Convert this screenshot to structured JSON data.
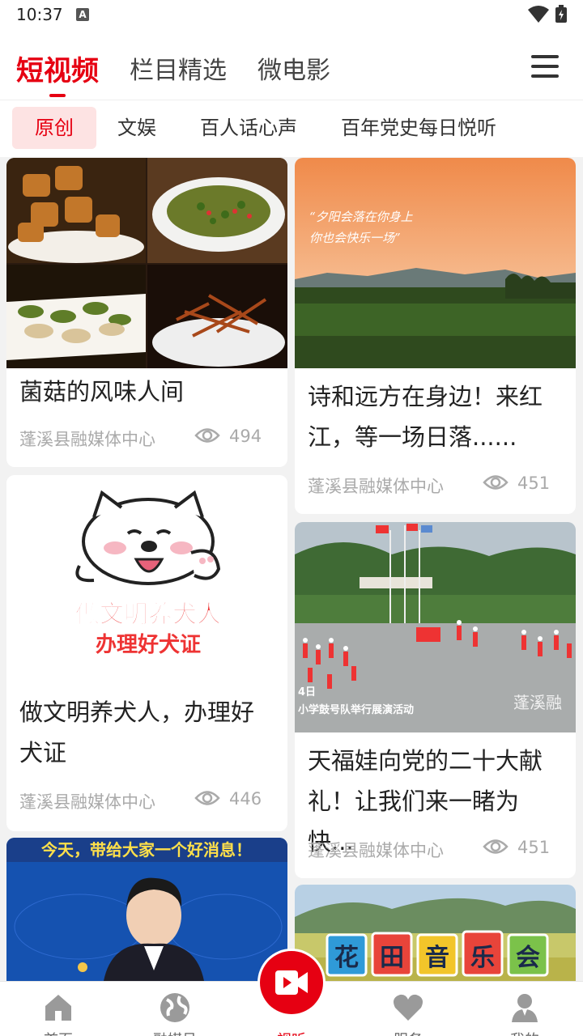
{
  "status": {
    "time": "10:37"
  },
  "top_tabs": [
    {
      "label": "短视频"
    },
    {
      "label": "栏目精选"
    },
    {
      "label": "微电影"
    }
  ],
  "sub_tabs": [
    {
      "label": "原创"
    },
    {
      "label": "文娱"
    },
    {
      "label": "百人话心声"
    },
    {
      "label": "百年党史每日悦听"
    }
  ],
  "cards": [
    {
      "title": "菌菇的风味人间",
      "source": "蓬溪县融媒体中心",
      "views": "494"
    },
    {
      "title": "诗和远方在身边！来红江，等一场日落......",
      "source": "蓬溪县融媒体中心",
      "views": "451",
      "overlay_text": "“夕阳会落在你身上 你也会快乐一场”"
    },
    {
      "title": "做文明养犬人，办理好犬证",
      "source": "蓬溪县融媒体中心",
      "views": "446",
      "overlay_text": "做文明养犬人 办理好犬证"
    },
    {
      "title": "天福娃向党的二十大献礼！让我们来一睹为快...",
      "source": "蓬溪县融媒体中心",
      "views": "451",
      "overlay_text": "4日 小学鼓号队举行展演活动",
      "watermark": "蓬溪融"
    },
    {
      "overlay_text": "今天，带给大家一个好消息！"
    },
    {
      "overlay_text": "花田音乐会"
    }
  ],
  "bottom_nav": [
    {
      "label": "首页",
      "icon": "home-icon"
    },
    {
      "label": "融媒号",
      "icon": "globe-icon"
    },
    {
      "label": "视听",
      "icon": "video-icon"
    },
    {
      "label": "服务",
      "icon": "heart-icon"
    },
    {
      "label": "我的",
      "icon": "user-icon"
    }
  ],
  "colors": {
    "accent": "#e60012",
    "subtab_active_bg": "#fde3e3",
    "meta": "#aaaaaa"
  }
}
